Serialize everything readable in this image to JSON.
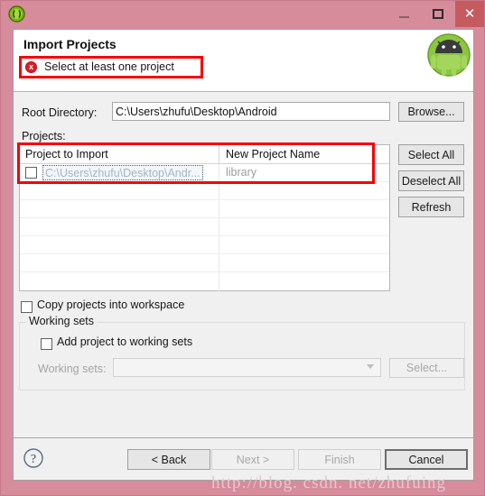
{
  "window": {
    "app_icon": "eclipse-icon",
    "minimize_label": "–",
    "maximize_label": "□",
    "close_label": "✕",
    "titlebar_color": "#d78c9b",
    "close_button_color": "#c55a5f"
  },
  "header": {
    "title": "Import Projects",
    "error_icon": "error-circle-icon",
    "error_glyph": "x",
    "error_message": "Select at least one project",
    "error_highlight_color": "#f50000",
    "logo": "android-robot-logo"
  },
  "form": {
    "root_directory_label": "Root Directory:",
    "root_directory_value": "C:\\Users\\zhufu\\Desktop\\Android",
    "root_directory_placeholder": "",
    "browse_label": "Browse...",
    "projects_label": "Projects:"
  },
  "table": {
    "columns": [
      "Project to Import",
      "New Project Name"
    ],
    "rows": [
      {
        "checked": false,
        "project_to_import": "C:\\Users\\zhufu\\Desktop\\Andr...",
        "new_project_name": "library"
      }
    ],
    "empty_row_count": 6,
    "highlight_color": "#f50000"
  },
  "side_buttons": {
    "select_all": "Select All",
    "deselect_all": "Deselect All",
    "refresh": "Refresh"
  },
  "options": {
    "copy_into_workspace_label": "Copy projects into workspace",
    "copy_into_workspace_checked": false
  },
  "working_sets": {
    "group_title": "Working sets",
    "add_checkbox_label": "Add project to working sets",
    "add_checkbox_checked": false,
    "select_label": "Working sets:",
    "select_value": "",
    "select_button_label": "Select...",
    "disabled": true
  },
  "footer": {
    "help_icon": "question-mark-icon",
    "help_glyph": "?",
    "back_label": "< Back",
    "next_label": "Next >",
    "finish_label": "Finish",
    "cancel_label": "Cancel",
    "back_enabled": true,
    "next_enabled": false,
    "finish_enabled": false,
    "cancel_enabled": true
  },
  "watermark": {
    "text": "http://blog. csdn. net/zhufuing"
  }
}
